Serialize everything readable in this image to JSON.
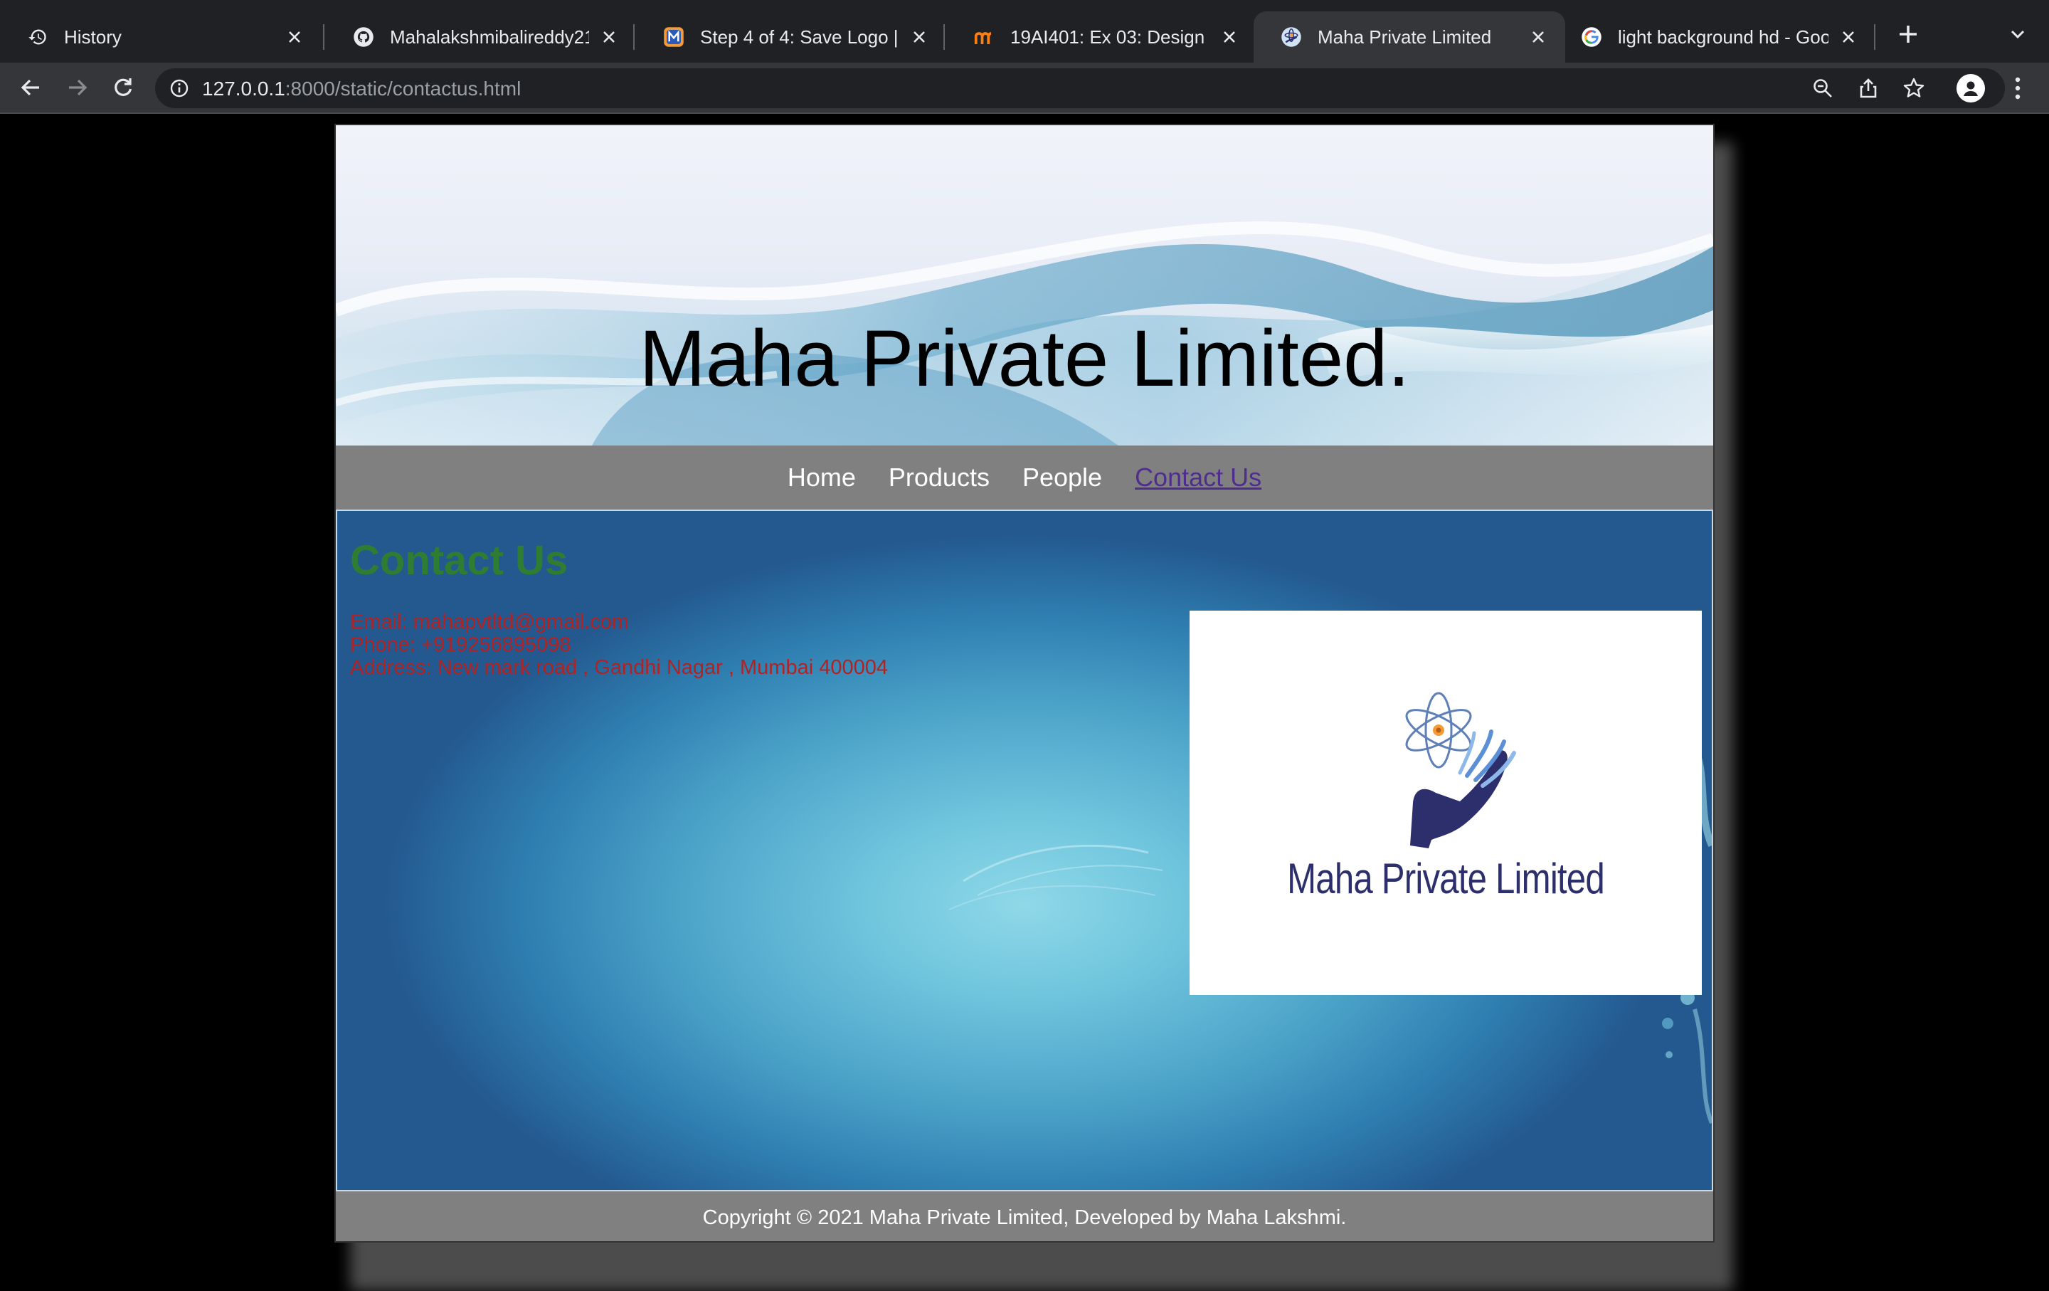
{
  "browser": {
    "tabs": [
      {
        "title": "History",
        "icon": "history-icon",
        "active": false
      },
      {
        "title": "Mahalakshmibalireddy2100",
        "icon": "github-icon",
        "active": false
      },
      {
        "title": "Step 4 of 4: Save Logo | Lo",
        "icon": "logo-maker-icon",
        "active": false
      },
      {
        "title": "19AI401: Ex 03: Design a W",
        "icon": "moodle-icon",
        "active": false
      },
      {
        "title": "Maha Private Limited",
        "icon": "site-favicon",
        "active": true
      },
      {
        "title": "light background hd - Goog",
        "icon": "google-icon",
        "active": false
      }
    ],
    "url_host": "127.0.0.1",
    "url_rest": ":8000/static/contactus.html"
  },
  "site": {
    "banner_title": "Maha Private Limited.",
    "nav": [
      {
        "label": "Home",
        "current": false
      },
      {
        "label": "Products",
        "current": false
      },
      {
        "label": "People",
        "current": false
      },
      {
        "label": "Contact Us",
        "current": true
      }
    ],
    "content_title": "Contact Us",
    "contact": {
      "email": "Email: mahapvtltd@gmail.com",
      "phone": "Phone: +919256895098",
      "address": "Address: New mark road , Gandhi Nagar , Mumbai 400004"
    },
    "logo_text": "Maha Private Limited",
    "footer": "Copyright © 2021 Maha Private Limited, Developed by Maha Lakshmi."
  },
  "colors": {
    "chrome_dark": "#202124",
    "chrome_mid": "#35363a",
    "nav_bg": "#808080",
    "content_title": "#2f7d32",
    "contact_text": "#b22222",
    "nav_current": "#4f2d8f",
    "logo_navy": "#2c2f6c"
  }
}
